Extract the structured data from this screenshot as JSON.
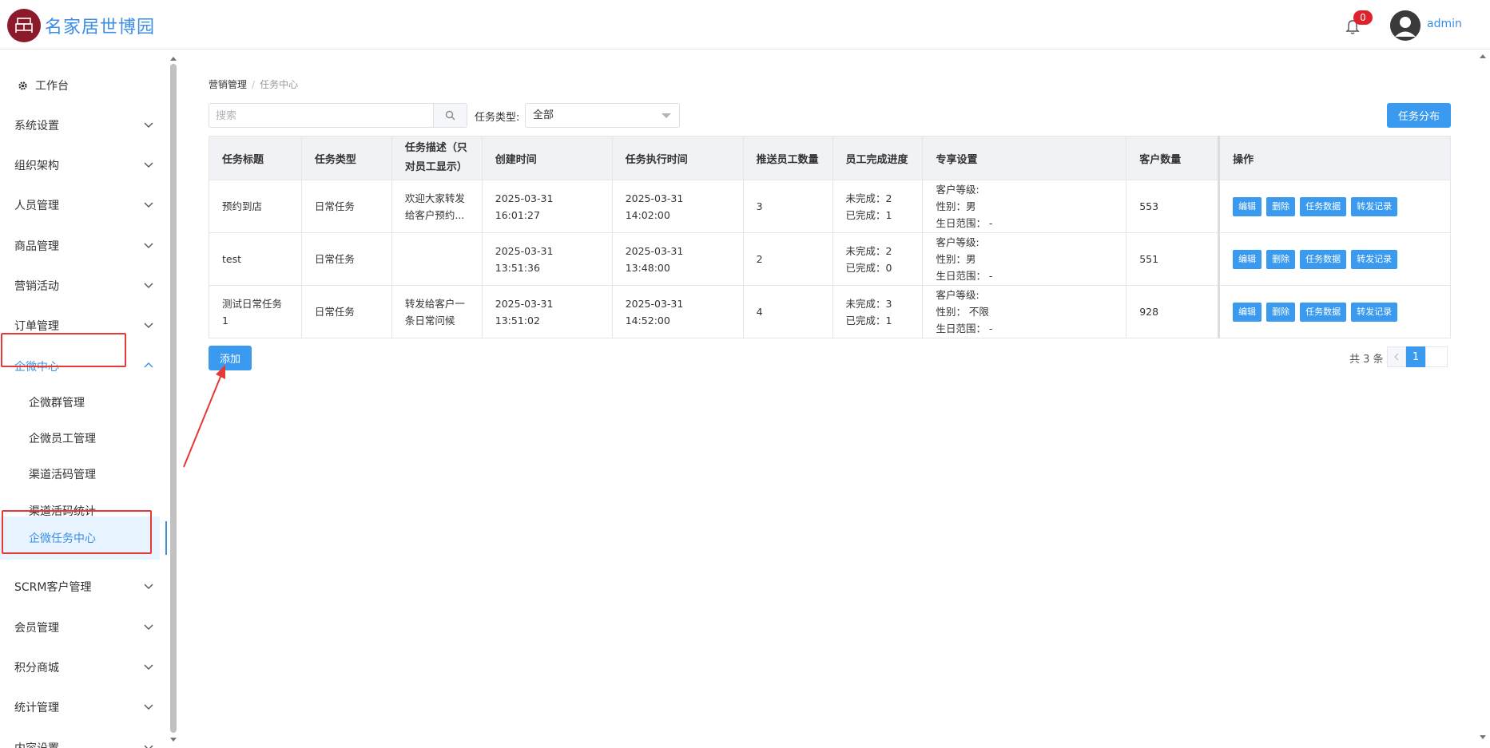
{
  "header": {
    "brand": "名家居世博园",
    "notification_count": "0",
    "username": "admin"
  },
  "sidebar": {
    "workbench": "工作台",
    "items": [
      {
        "label": "系统设置"
      },
      {
        "label": "组织架构"
      },
      {
        "label": "人员管理"
      },
      {
        "label": "商品管理"
      },
      {
        "label": "营销活动"
      },
      {
        "label": "订单管理"
      },
      {
        "label": "企微中心"
      },
      {
        "label": "SCRM客户管理"
      },
      {
        "label": "会员管理"
      },
      {
        "label": "积分商城"
      },
      {
        "label": "统计管理"
      },
      {
        "label": "内容设置"
      }
    ],
    "sub_items": [
      {
        "label": "企微群管理"
      },
      {
        "label": "企微员工管理"
      },
      {
        "label": "渠道活码管理"
      },
      {
        "label": "渠道活码统计"
      },
      {
        "label": "企微任务中心"
      }
    ]
  },
  "breadcrumb": {
    "parent": "营销管理",
    "separator": "/",
    "current": "任务中心"
  },
  "toolbar": {
    "search_placeholder": "搜索",
    "type_label": "任务类型:",
    "type_value": "全部",
    "distribute_label": "任务分布",
    "add_label": "添加"
  },
  "table": {
    "headers": {
      "title": "任务标题",
      "type": "任务类型",
      "desc_line1": "任务描述（只",
      "desc_line2": "对员工显示）",
      "created": "创建时间",
      "exec": "任务执行时间",
      "staff": "推送员工数量",
      "progress": "员工完成进度",
      "shared": "专享设置",
      "customers": "客户数量",
      "ops": "操作"
    },
    "rows": [
      {
        "title": "预约到店",
        "title2": "",
        "type": "日常任务",
        "desc1": "欢迎大家转发",
        "desc2": "给客户预约...",
        "created": "2025-03-31 16:01:27",
        "exec": "2025-03-31 14:02:00",
        "staff": "3",
        "undone": "未完成：2",
        "done": "已完成：1",
        "level": "客户等级:",
        "gender": "性别：男",
        "birthday": "生日范围： -",
        "customers": "553"
      },
      {
        "title": "test",
        "title2": "",
        "type": "日常任务",
        "desc1": "",
        "desc2": "",
        "created": "2025-03-31 13:51:36",
        "exec": "2025-03-31 13:48:00",
        "staff": "2",
        "undone": "未完成：2",
        "done": "已完成：0",
        "level": "客户等级:",
        "gender": "性别：男",
        "birthday": "生日范围： -",
        "customers": "551"
      },
      {
        "title": "测试日常任务",
        "title2": "1",
        "type": "日常任务",
        "desc1": "转发给客户一",
        "desc2": "条日常问候",
        "created": "2025-03-31 13:51:02",
        "exec": "2025-03-31 14:52:00",
        "staff": "4",
        "undone": "未完成：3",
        "done": "已完成：1",
        "level": "客户等级:",
        "gender": "性别：  不限",
        "birthday": "生日范围： -",
        "customers": "928"
      }
    ],
    "op_labels": {
      "edit": "编辑",
      "delete": "删除",
      "data": "任务数据",
      "forward": "转发记录"
    }
  },
  "pagination": {
    "total": "共 3 条",
    "current_page": "1"
  },
  "colors": {
    "primary": "#3a9af0",
    "brand_logo": "#8b1a2b",
    "highlight": "#e53935",
    "badge": "#e0202a"
  }
}
